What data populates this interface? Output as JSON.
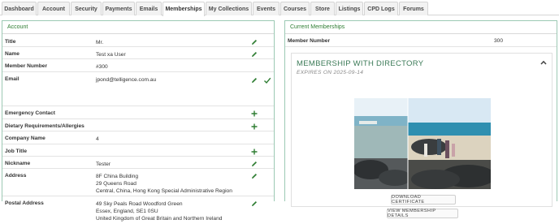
{
  "tabs": [
    {
      "label": "Dashboard",
      "active": false
    },
    {
      "label": "Account",
      "active": false
    },
    {
      "label": "Security",
      "active": false
    },
    {
      "label": "Payments",
      "active": false
    },
    {
      "label": "Emails",
      "active": false
    },
    {
      "label": "Memberships",
      "active": true
    },
    {
      "label": "My Collections",
      "active": false
    },
    {
      "label": "Events",
      "active": false
    },
    {
      "label": "Courses",
      "active": false
    },
    {
      "label": "Store",
      "active": false
    },
    {
      "label": "Listings",
      "active": false
    },
    {
      "label": "CPD Logs",
      "active": false
    },
    {
      "label": "Forums",
      "active": false
    }
  ],
  "account": {
    "header": "Account",
    "rows": [
      {
        "label": "Title",
        "value": [
          "Mr."
        ],
        "action": "edit"
      },
      {
        "label": "Name",
        "value": [
          "Test xa User"
        ],
        "action": "edit"
      },
      {
        "label": "Member Number",
        "value": [
          "#300"
        ],
        "action": "none"
      },
      {
        "label": "Email",
        "value": [
          "jpond@telligence.com.au"
        ],
        "action": "edit",
        "verified": true
      },
      {
        "label": "Emergency Contact",
        "value": [],
        "action": "add"
      },
      {
        "label": "Dietary Requirements/Allergies",
        "value": [],
        "action": "add"
      },
      {
        "label": "Company Name",
        "value": [
          "4"
        ],
        "action": "none"
      },
      {
        "label": "Job Title",
        "value": [],
        "action": "add"
      },
      {
        "label": "Nickname",
        "value": [
          "Tester"
        ],
        "action": "edit"
      },
      {
        "label": "Address",
        "value": [
          "8F China Building",
          "29 Queens Road",
          "Central, China, Hong Kong Special Administrative Region"
        ],
        "action": "edit"
      },
      {
        "label": "Postal Address",
        "value": [
          "49 Sky Peals Road Woodford Green",
          "Essex, England, SE1 0SU",
          "United Kingdom of Great Britain and Northern Ireland"
        ],
        "action": "edit"
      }
    ]
  },
  "memberships": {
    "header": "Current Memberships",
    "member_number_label": "Member Number",
    "member_number_value": "300",
    "card": {
      "title": "MEMBERSHIP WITH DIRECTORY",
      "expires": "EXPIRES ON 2025-09-14",
      "download_label": "DOWNLOAD CERTIFICATE",
      "view_label": "VIEW MEMBERSHIP DETAILS"
    }
  },
  "colors": {
    "accent": "#2e7d32",
    "panel_border": "#9cc9b4",
    "icon": "#2e7d32"
  },
  "icons": {
    "edit": "pencil-icon",
    "add": "plus-icon",
    "verified": "check-icon",
    "collapse": "chevron-up-icon"
  }
}
